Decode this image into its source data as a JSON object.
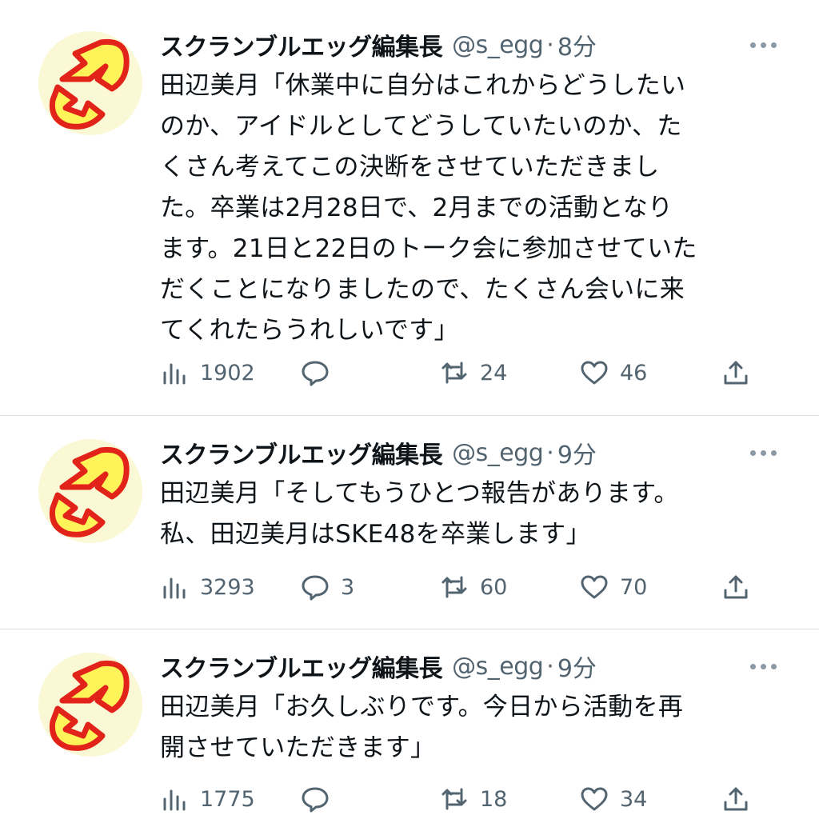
{
  "tweets": [
    {
      "author": "スクランブルエッグ編集長",
      "handle": "@s_egg",
      "separator": "·",
      "time": "8分",
      "text": "田辺美月「休業中に自分はこれからどうしたい\nのか、アイドルとしてどうしていたいのか、た\nくさん考えてこの決断をさせていただきまし\nた。卒業は2月28日で、2月までの活動となり\nます。21日と22日のトーク会に参加させていた\nだくことになりましたので、たくさん会いに来\nてくれたらうれしいです」",
      "views": "1902",
      "replies": "",
      "retweets": "24",
      "likes": "46"
    },
    {
      "author": "スクランブルエッグ編集長",
      "handle": "@s_egg",
      "separator": "·",
      "time": "9分",
      "text": "田辺美月「そしてもうひとつ報告があります。\n私、田辺美月はSKE48を卒業します」",
      "views": "3293",
      "replies": "3",
      "retweets": "60",
      "likes": "70"
    },
    {
      "author": "スクランブルエッグ編集長",
      "handle": "@s_egg",
      "separator": "·",
      "time": "9分",
      "text": "田辺美月「お久しぶりです。今日から活動を再\n開させていただきます」",
      "views": "1775",
      "replies": "",
      "retweets": "18",
      "likes": "34"
    }
  ],
  "icons": {
    "avatar": "scrambled-egg-logo",
    "more": "more-horizontal-icon",
    "views": "views-bar-chart-icon",
    "reply": "reply-speech-bubble-icon",
    "retweet": "retweet-icon",
    "like": "heart-icon",
    "share": "share-upload-icon"
  },
  "colors": {
    "text_primary": "#0f1419",
    "text_secondary": "#536471",
    "divider": "#dcdfe2",
    "logo_red": "#e2231a",
    "logo_yellow": "#fff35a"
  }
}
